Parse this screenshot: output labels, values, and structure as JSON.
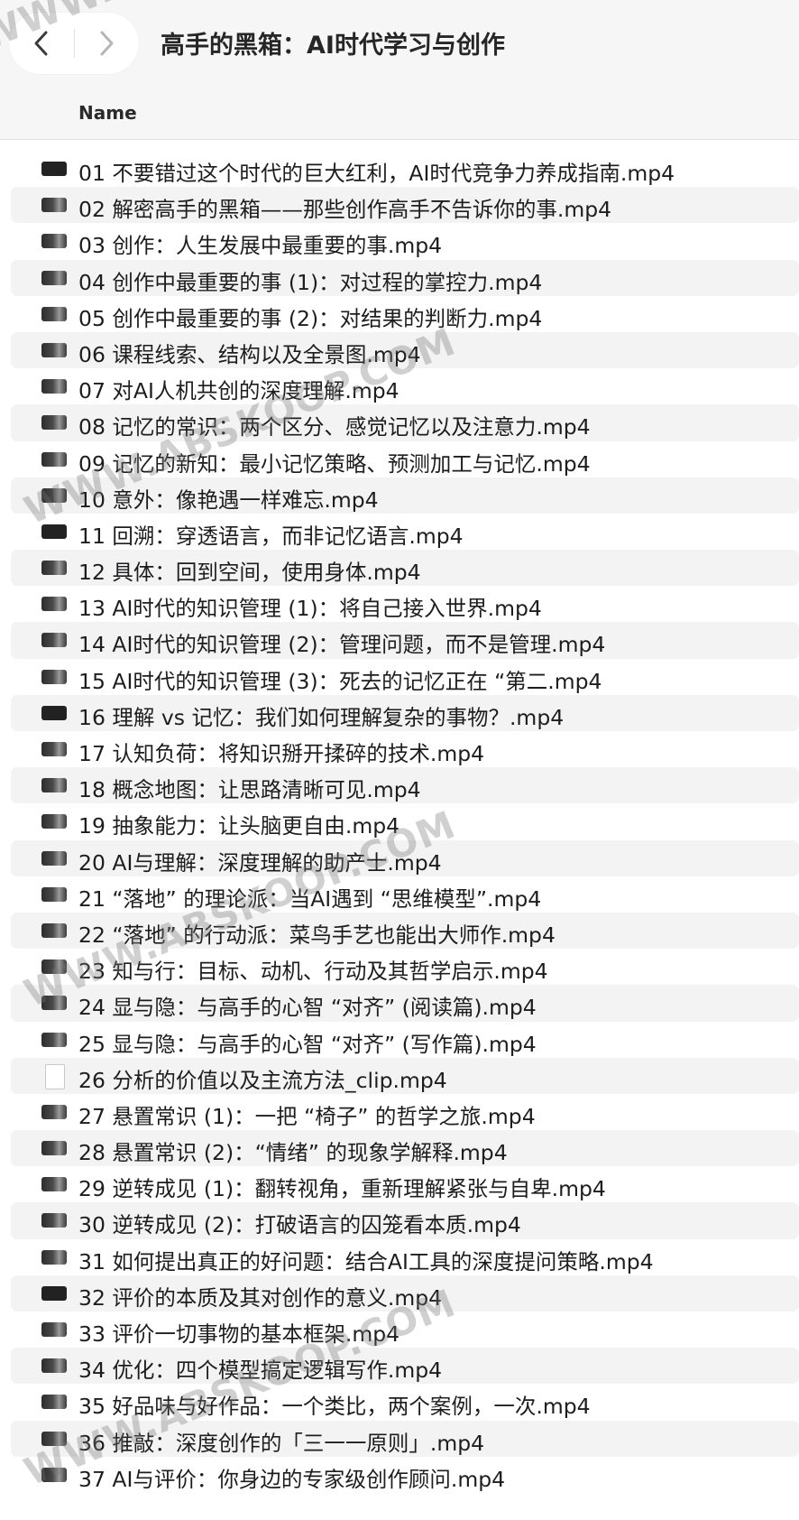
{
  "window": {
    "title": "高手的黑箱：AI时代学习与创作"
  },
  "nav": {
    "back_icon": "chevron-left-icon",
    "forward_icon": "chevron-right-icon"
  },
  "columns": {
    "name": "Name"
  },
  "files": [
    {
      "name": "01 不要错过这个时代的巨大红利，AI时代竞争力养成指南.mp4",
      "icon": "video-thumbnail-icon"
    },
    {
      "name": "02 解密高手的黑箱——那些创作高手不告诉你的事.mp4",
      "icon": "video-thumbnail-icon"
    },
    {
      "name": "03 创作：人生发展中最重要的事.mp4",
      "icon": "video-thumbnail-icon"
    },
    {
      "name": "04 创作中最重要的事 (1)：对过程的掌控力.mp4",
      "icon": "video-thumbnail-icon"
    },
    {
      "name": "05 创作中最重要的事 (2)：对结果的判断力.mp4",
      "icon": "video-thumbnail-icon"
    },
    {
      "name": "06 课程线索、结构以及全景图.mp4",
      "icon": "video-thumbnail-icon"
    },
    {
      "name": "07 对AI人机共创的深度理解.mp4",
      "icon": "video-thumbnail-icon"
    },
    {
      "name": "08 记忆的常识：两个区分、感觉记忆以及注意力.mp4",
      "icon": "video-thumbnail-icon"
    },
    {
      "name": "09 记忆的新知：最小记忆策略、预测加工与记忆.mp4",
      "icon": "video-thumbnail-icon"
    },
    {
      "name": "10 意外：像艳遇一样难忘.mp4",
      "icon": "video-thumbnail-icon"
    },
    {
      "name": "11 回溯：穿透语言，而非记忆语言.mp4",
      "icon": "video-thumbnail-icon"
    },
    {
      "name": "12 具体：回到空间，使用身体.mp4",
      "icon": "video-thumbnail-icon"
    },
    {
      "name": "13 AI时代的知识管理 (1)：将自己接入世界.mp4",
      "icon": "video-thumbnail-icon"
    },
    {
      "name": "14 AI时代的知识管理 (2)：管理问题，而不是管理.mp4",
      "icon": "video-thumbnail-icon"
    },
    {
      "name": "15 AI时代的知识管理 (3)：死去的记忆正在 “第二.mp4",
      "icon": "video-thumbnail-icon"
    },
    {
      "name": "16 理解 vs 记忆：我们如何理解复杂的事物？.mp4",
      "icon": "video-thumbnail-icon"
    },
    {
      "name": "17 认知负荷：将知识掰开揉碎的技术.mp4",
      "icon": "video-thumbnail-icon"
    },
    {
      "name": "18 概念地图：让思路清晰可见.mp4",
      "icon": "video-thumbnail-icon"
    },
    {
      "name": "19 抽象能力：让头脑更自由.mp4",
      "icon": "video-thumbnail-icon"
    },
    {
      "name": "20 AI与理解：深度理解的助产士.mp4",
      "icon": "video-thumbnail-icon"
    },
    {
      "name": "21 “落地” 的理论派：当AI遇到 “思维模型”.mp4",
      "icon": "video-thumbnail-icon"
    },
    {
      "name": "22 “落地” 的行动派：菜鸟手艺也能出大师作.mp4",
      "icon": "video-thumbnail-icon"
    },
    {
      "name": "23 知与行：目标、动机、行动及其哲学启示.mp4",
      "icon": "video-thumbnail-icon"
    },
    {
      "name": "24 显与隐：与高手的心智 “对齐” (阅读篇).mp4",
      "icon": "video-thumbnail-icon"
    },
    {
      "name": "25 显与隐：与高手的心智 “对齐” (写作篇).mp4",
      "icon": "video-thumbnail-icon"
    },
    {
      "name": "26 分析的价值以及主流方法_clip.mp4",
      "icon": "document-icon"
    },
    {
      "name": "27 悬置常识 (1)：一把 “椅子” 的哲学之旅.mp4",
      "icon": "video-thumbnail-icon"
    },
    {
      "name": "28 悬置常识 (2)：“情绪” 的现象学解释.mp4",
      "icon": "video-thumbnail-icon"
    },
    {
      "name": "29 逆转成见 (1)：翻转视角，重新理解紧张与自卑.mp4",
      "icon": "video-thumbnail-icon"
    },
    {
      "name": "30 逆转成见 (2)：打破语言的囚笼看本质.mp4",
      "icon": "video-thumbnail-icon"
    },
    {
      "name": "31 如何提出真正的好问题：结合AI工具的深度提问策略.mp4",
      "icon": "video-thumbnail-icon"
    },
    {
      "name": "32 评价的本质及其对创作的意义.mp4",
      "icon": "video-thumbnail-icon"
    },
    {
      "name": "33 评价一切事物的基本框架.mp4",
      "icon": "video-thumbnail-icon"
    },
    {
      "name": "34 优化：四个模型搞定逻辑写作.mp4",
      "icon": "video-thumbnail-icon"
    },
    {
      "name": "35 好品味与好作品：一个类比，两个案例，一次.mp4",
      "icon": "video-thumbnail-icon"
    },
    {
      "name": "36 推敲：深度创作的「三一一原则」.mp4",
      "icon": "video-thumbnail-icon"
    },
    {
      "name": "37 AI与评价：你身边的专家级创作顾问.mp4",
      "icon": "video-thumbnail-icon"
    }
  ],
  "watermark": {
    "text": "WWW.ABSKOOP.COM"
  }
}
